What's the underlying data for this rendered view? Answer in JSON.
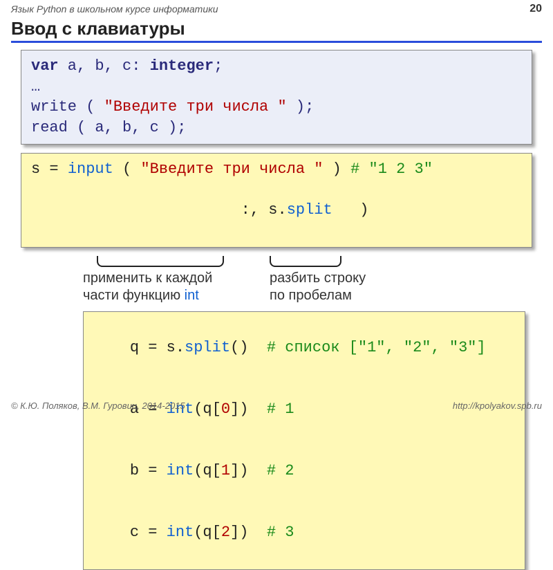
{
  "header": {
    "course": "Язык Python в школьном курсе информатики",
    "page": "20"
  },
  "title": "Ввод с клавиатуры",
  "pascal": {
    "line1_a": "var",
    "line1_b": " a, b, c: ",
    "line1_c": "integer",
    "line1_d": ";",
    "line2": "…",
    "line3_a": "write ( ",
    "line3_b": "\"Введите три числа \"",
    "line3_c": " );",
    "line4": "read ( a, b, c );"
  },
  "py1": {
    "l1_a": "s = ",
    "l1_b": "input",
    "l1_c": " ( ",
    "l1_d": "\"Введите три числа \"",
    "l1_e": " ) ",
    "l1_f": "# \"1 2 3\"",
    "l2_a": "              ",
    "l2_b": "     :",
    "l2_c": ", s.",
    "l2_d": "split",
    "l2_e": "   )"
  },
  "annot": {
    "left1": "применить к каждой",
    "left2_a": "части функцию ",
    "left2_b": "int",
    "right1": "разбить строку",
    "right2": "по пробелам"
  },
  "py2": {
    "l1_a": "q = s.",
    "l1_b": "split",
    "l1_c": "()  ",
    "l1_d": "# список [\"1\", \"2\", \"3\"]",
    "l2_a": "a = ",
    "l2_b": "int",
    "l2_c": "(q[",
    "l2_n": "0",
    "l2_d": "])  ",
    "l2_e": "# 1",
    "l3_a": "b = ",
    "l3_b": "int",
    "l3_c": "(q[",
    "l3_n": "1",
    "l3_d": "])  ",
    "l3_e": "# 2",
    "l4_a": "c = ",
    "l4_b": "int",
    "l4_c": "(q[",
    "l4_n": "2",
    "l4_d": "])  ",
    "l4_e": "# 3"
  },
  "footer": {
    "left": "© К.Ю. Поляков, В.М. Гуровиц, 2014-2015",
    "right": "http://kpolyakov.spb.ru"
  }
}
